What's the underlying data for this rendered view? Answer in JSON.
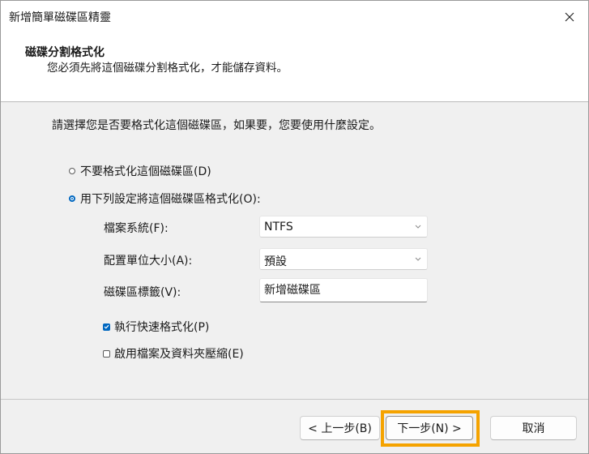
{
  "window": {
    "title": "新增簡單磁碟區精靈"
  },
  "header": {
    "title": "磁碟分割格式化",
    "subtitle": "您必須先將這個磁碟分割格式化，才能儲存資料。"
  },
  "body": {
    "prompt": "請選擇您是否要格式化這個磁碟區，如果要，您要使用什麼設定。",
    "options": {
      "no_format": {
        "label": "不要格式化這個磁碟區(D)",
        "selected": false
      },
      "format": {
        "label": "用下列設定將這個磁碟區格式化(O):",
        "selected": true
      }
    },
    "fields": {
      "filesystem": {
        "label": "檔案系統(F):",
        "value": "NTFS"
      },
      "allocation": {
        "label": "配置單位大小(A):",
        "value": "預設"
      },
      "volume_label": {
        "label": "磁碟區標籤(V):",
        "value": "新增磁碟區"
      }
    },
    "checks": {
      "quick_format": {
        "label": "執行快速格式化(P)",
        "checked": true
      },
      "compression": {
        "label": "啟用檔案及資料夾壓縮(E)",
        "checked": false
      }
    }
  },
  "footer": {
    "back_label": "< 上一步(B)",
    "next_label": "下一步(N) >",
    "cancel_label": "取消"
  },
  "colors": {
    "accent": "#0067c0",
    "highlight": "#f5a300"
  },
  "icons": {
    "close": "close-icon",
    "dropdown": "chevron-down-icon",
    "check": "checkmark-icon"
  }
}
